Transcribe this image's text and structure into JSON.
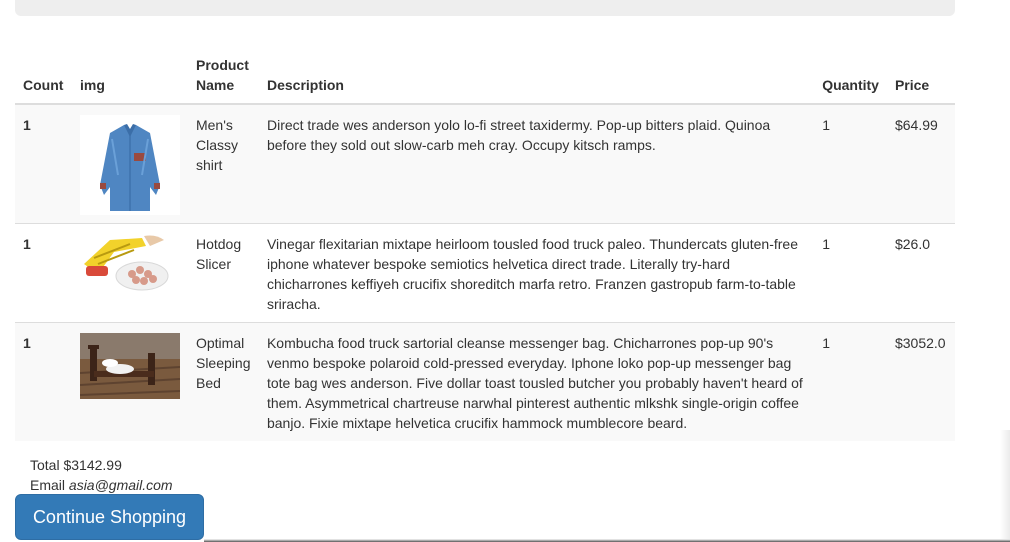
{
  "table": {
    "headers": {
      "count": "Count",
      "img": "img",
      "product_name": "Product Name",
      "description": "Description",
      "quantity": "Quantity",
      "price": "Price"
    },
    "rows": [
      {
        "count": "1",
        "image_icon": "shirt-image",
        "name": "Men's Classy shirt",
        "description": "Direct trade wes anderson yolo lo-fi street taxidermy. Pop-up bitters plaid. Quinoa before they sold out slow-carb meh cray. Occupy kitsch ramps.",
        "quantity": "1",
        "price": "$64.99"
      },
      {
        "count": "1",
        "image_icon": "hotdog-slicer-image",
        "name": "Hotdog Slicer",
        "description": "Vinegar flexitarian mixtape heirloom tousled food truck paleo. Thundercats gluten-free iphone whatever bespoke semiotics helvetica direct trade. Literally try-hard chicharrones keffiyeh crucifix shoreditch marfa retro. Franzen gastropub farm-to-table sriracha.",
        "quantity": "1",
        "price": "$26.0"
      },
      {
        "count": "1",
        "image_icon": "sleeping-bed-image",
        "name": "Optimal Sleeping Bed",
        "description": "Kombucha food truck sartorial cleanse messenger bag. Chicharrones pop-up 90's venmo bespoke polaroid cold-pressed everyday. Iphone loko pop-up messenger bag tote bag wes anderson. Five dollar toast tousled butcher you probably haven't heard of them. Asymmetrical chartreuse narwhal pinterest authentic mlkshk single-origin coffee banjo. Fixie mixtape helvetica crucifix hammock mumblecore beard.",
        "quantity": "1",
        "price": "$3052.0"
      }
    ]
  },
  "summary": {
    "total_label": "Total",
    "total_value": "$3142.99",
    "email_label": "Email",
    "email_value": "asia@gmail.com"
  },
  "actions": {
    "continue_label": "Continue Shopping"
  },
  "colors": {
    "primary": "#337ab7",
    "stripe": "#f9f9f9",
    "border": "#dddddd"
  }
}
